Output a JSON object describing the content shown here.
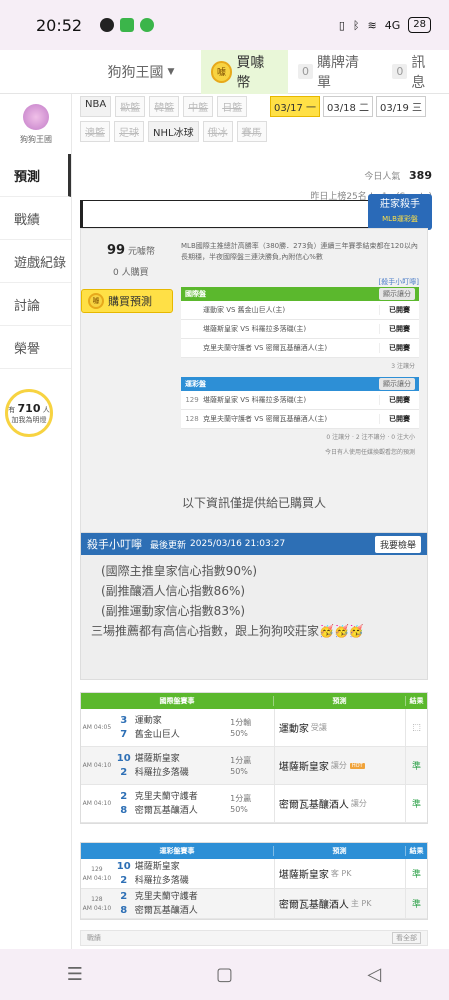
{
  "status": {
    "time": "20:52",
    "battery": "28",
    "net": "4G"
  },
  "nav": {
    "kingdom": "狗狗王國",
    "buy": "買噱幣",
    "coin": "噱",
    "cart_count": "0",
    "cart": "購牌清單",
    "msg_count": "0",
    "msg": "訊息"
  },
  "sidebar": {
    "user": "狗狗王國",
    "items": [
      "預測",
      "戰績",
      "遊戲紀錄",
      "討論",
      "榮譽"
    ],
    "bulb_prefix": "有",
    "bulb_num": "710",
    "bulb_unit": "人",
    "bulb_text": "加我為明燈"
  },
  "leagues": [
    {
      "label": "NBA",
      "active": true
    },
    {
      "label": "歐籃",
      "active": false
    },
    {
      "label": "韓籃",
      "active": false
    },
    {
      "label": "中籃",
      "active": false
    },
    {
      "label": "日籃",
      "active": false
    },
    {
      "label": "澳籃",
      "active": false
    },
    {
      "label": "足球",
      "active": false
    },
    {
      "label": "NHL冰球",
      "active": true
    },
    {
      "label": "俄冰",
      "active": false
    },
    {
      "label": "賽馬",
      "active": false
    }
  ],
  "dates": [
    {
      "label": "03/17 一",
      "selected": true
    },
    {
      "label": "03/18 二",
      "selected": false
    },
    {
      "label": "03/19 三",
      "selected": false
    }
  ],
  "stats": {
    "today_label": "今日人氣",
    "today": "389",
    "rank": "昨日上榜25名 ! · 1 · (Sports)"
  },
  "killer": {
    "title": "莊家殺手",
    "sub": "MLB運彩盤"
  },
  "preview": {
    "price": "99",
    "price_unit": "元噱幣",
    "buyers": "0",
    "buyers_unit": "人購買",
    "buy_label": "購買預測",
    "desc": "MLB國際主推總計高勝率（380勝．273負）連續三年賽季結束都在120以內\n長期穩，半夜國際盤三連決勝負,內附信心%數",
    "link": "[殺手小叮嚀]",
    "intl_title": "國際盤",
    "show_btn": "顯示讓分",
    "intl_rows": [
      {
        "num": "",
        "text": "運動家 VS 舊金山巨人(主)",
        "res": "已開賽"
      },
      {
        "num": "",
        "text": "堪薩斯皇家 VS 科羅拉多落磯(主)",
        "res": "已開賽"
      },
      {
        "num": "",
        "text": "克里夫蘭守護者 VS 密爾瓦基釀酒人(主)",
        "res": "已開賽"
      }
    ],
    "intl_foot": "3 注讓分",
    "lottery_title": "運彩盤",
    "lottery_rows": [
      {
        "num": "129",
        "text": "堪薩斯皇家 VS 科羅拉多落磯(主)",
        "res": "已開賽"
      },
      {
        "num": "128",
        "text": "克里夫蘭守護者 VS 密爾瓦基釀酒人(主)",
        "res": "已開賽"
      }
    ],
    "lottery_foot": "0 注讓分 · 2 注不讓分 · 0 注大小",
    "today_note": "今日有人使用任媒換觀看您的預測"
  },
  "notice": "以下資訊僅提供給已購買人",
  "tip": {
    "title": "殺手小叮嚀",
    "update_label": "最後更新",
    "update": "2025/03/16 21:03:27",
    "check": "我要檢舉",
    "lines": [
      "(國際主推皇家信心指數90%)",
      "(副推釀酒人信心指數86%)",
      "(副推運動家信心指數83%)",
      "三場推薦都有高信心指數，跟上狗狗咬莊家🥳🥳🥳"
    ]
  },
  "intl_results": {
    "head": [
      "國際盤賽事",
      "預測",
      "結果"
    ],
    "rows": [
      {
        "time": "AM 04:05",
        "n1": "3",
        "n2": "7",
        "t1": "運動家",
        "t2": "舊金山巨人",
        "odds1": "1分輸",
        "odds2": "50%",
        "pick": "運動家",
        "pick_note": "受讓",
        "hot": false,
        "res": "⬚"
      },
      {
        "time": "AM 04:10",
        "n1": "10",
        "n2": "2",
        "t1": "堪薩斯皇家",
        "t2": "科羅拉多落磯",
        "odds1": "1分贏",
        "odds2": "50%",
        "pick": "堪薩斯皇家",
        "pick_note": "讓分",
        "hot": true,
        "res": "準"
      },
      {
        "time": "AM 04:10",
        "n1": "2",
        "n2": "8",
        "t1": "克里夫蘭守護者",
        "t2": "密爾瓦基釀酒人",
        "odds1": "1分贏",
        "odds2": "50%",
        "pick": "密爾瓦基釀酒人",
        "pick_note": "讓分",
        "hot": false,
        "res": "準"
      }
    ]
  },
  "lottery_results": {
    "head": [
      "運彩盤賽事",
      "預測",
      "結果"
    ],
    "rows": [
      {
        "code": "129",
        "time": "AM 04:10",
        "n1": "10",
        "n2": "2",
        "t1": "堪薩斯皇家",
        "t2": "科羅拉多落磯",
        "pick": "堪薩斯皇家",
        "pick_note": "客 PK",
        "res": "準"
      },
      {
        "code": "128",
        "time": "AM 04:10",
        "n1": "2",
        "n2": "8",
        "t1": "克里夫蘭守護者",
        "t2": "密爾瓦基釀酒人",
        "pick": "密爾瓦基釀酒人",
        "pick_note": "主 PK",
        "res": "準"
      }
    ]
  },
  "bottom": {
    "label": "戰績",
    "more": "看全部"
  },
  "colors": {
    "green": "#5bb82d",
    "blue": "#2d6fb5",
    "yellow": "#ffe046"
  }
}
